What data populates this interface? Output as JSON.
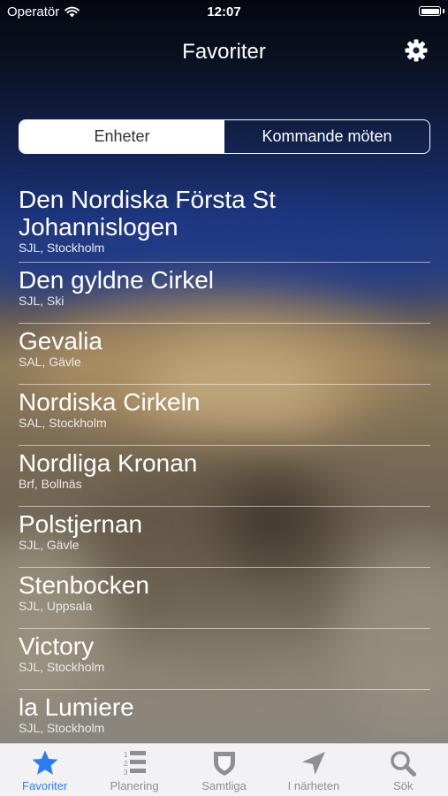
{
  "status_bar": {
    "carrier": "Operatör",
    "time": "12:07",
    "wifi_icon": "wifi-icon",
    "battery_icon": "battery-icon"
  },
  "nav_bar": {
    "title": "Favoriter",
    "settings_icon": "gear-icon"
  },
  "segmented_control": {
    "segments": [
      {
        "label": "Enheter",
        "selected": true
      },
      {
        "label": "Kommande möten",
        "selected": false
      }
    ]
  },
  "favorites": [
    {
      "name": "Den Nordiska Första St Johannislogen",
      "detail": "SJL, Stockholm"
    },
    {
      "name": "Den gyldne Cirkel",
      "detail": "SJL, Ski"
    },
    {
      "name": "Gevalia",
      "detail": "SAL, Gävle"
    },
    {
      "name": "Nordiska Cirkeln",
      "detail": "SAL, Stockholm"
    },
    {
      "name": "Nordliga Kronan",
      "detail": "Brf, Bollnäs"
    },
    {
      "name": "Polstjernan",
      "detail": "SJL, Gävle"
    },
    {
      "name": "Stenbocken",
      "detail": "SJL, Uppsala"
    },
    {
      "name": "Victory",
      "detail": "SJL, Stockholm"
    },
    {
      "name": "la Lumiere",
      "detail": "SJL, Stockholm"
    }
  ],
  "tab_bar": {
    "tabs": [
      {
        "label": "Favoriter",
        "icon": "star-icon",
        "active": true
      },
      {
        "label": "Planering",
        "icon": "numbered-list-icon",
        "active": false
      },
      {
        "label": "Samtliga",
        "icon": "shield-icon",
        "active": false
      },
      {
        "label": "I närheten",
        "icon": "location-arrow-icon",
        "active": false
      },
      {
        "label": "Sök",
        "icon": "search-icon",
        "active": false
      }
    ]
  },
  "colors": {
    "accent": "#2d7cf6",
    "tab_inactive": "#8e8e93",
    "tab_bar_background": "#f6f6f8",
    "text": "#ffffff"
  }
}
